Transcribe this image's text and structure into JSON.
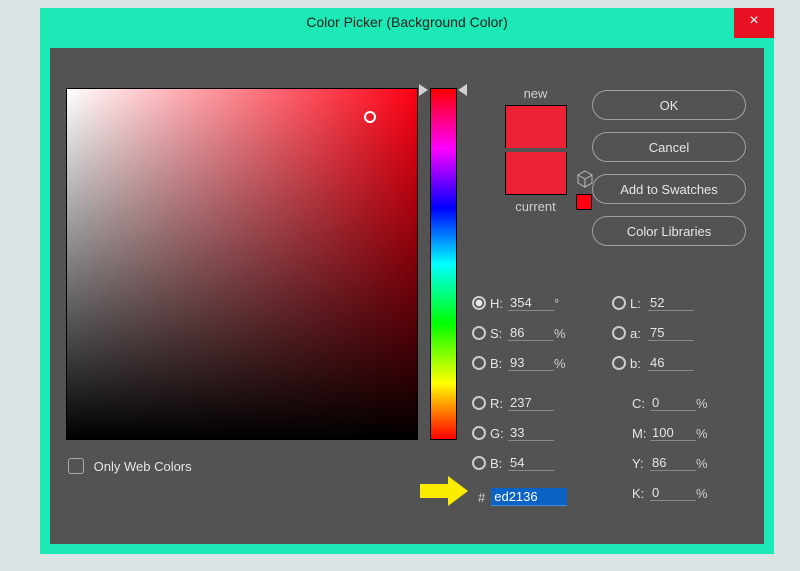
{
  "window": {
    "title": "Color Picker (Background Color)"
  },
  "buttons": {
    "ok": "OK",
    "cancel": "Cancel",
    "add": "Add to Swatches",
    "libs": "Color Libraries"
  },
  "preview": {
    "new_label": "new",
    "current_label": "current",
    "new_color": "#ed2136",
    "current_color": "#ed2136"
  },
  "only_web": {
    "label": "Only Web Colors"
  },
  "hsb": {
    "h_label": "H:",
    "h_val": "354",
    "h_unit": "°",
    "s_label": "S:",
    "s_val": "86",
    "s_unit": "%",
    "b_label": "B:",
    "b_val": "93",
    "b_unit": "%"
  },
  "rgb": {
    "r_label": "R:",
    "r_val": "237",
    "g_label": "G:",
    "g_val": "33",
    "b_label": "B:",
    "b_val": "54"
  },
  "lab": {
    "l_label": "L:",
    "l_val": "52",
    "a_label": "a:",
    "a_val": "75",
    "b_label": "b:",
    "b_val": "46"
  },
  "cmyk": {
    "c_label": "C:",
    "c_val": "0",
    "c_unit": "%",
    "m_label": "M:",
    "m_val": "100",
    "m_unit": "%",
    "y_label": "Y:",
    "y_val": "86",
    "y_unit": "%",
    "k_label": "K:",
    "k_val": "0",
    "k_unit": "%"
  },
  "hex": {
    "hash": "#",
    "value": "ed2136"
  }
}
